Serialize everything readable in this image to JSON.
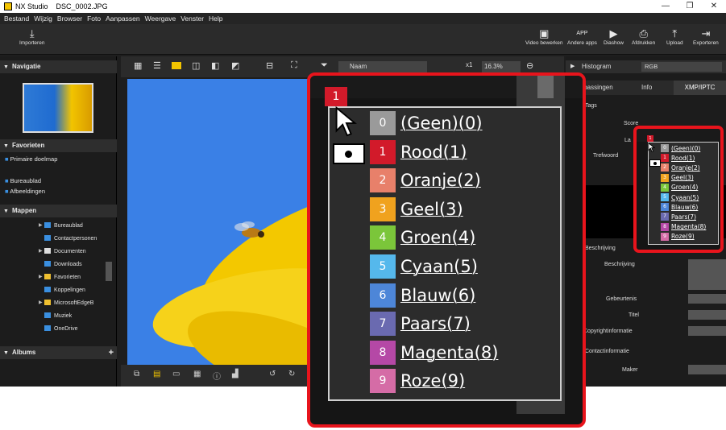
{
  "window": {
    "app_name": "NX Studio",
    "file_name": "DSC_0002.JPG",
    "controls": [
      "—",
      "❐",
      "✕"
    ]
  },
  "menu": [
    "Bestand",
    "Wijzig",
    "Browser",
    "Foto",
    "Aanpassen",
    "Weergave",
    "Venster",
    "Help"
  ],
  "toolbar": {
    "import": "Importeren",
    "video": "Video bewerken",
    "apps": "Andere apps",
    "slideshow": "Diashow",
    "print": "Afdrukken",
    "upload": "Upload",
    "export": "Exporteren",
    "app_badge": "APP"
  },
  "left_panel": {
    "navigation": "Navigatie",
    "favorites": "Favorieten",
    "primary_folder": "Primaire doelmap",
    "desktop": "Bureaublad",
    "pictures": "Afbeeldingen",
    "folders": "Mappen",
    "albums": "Albums",
    "folder_items": [
      "Bureaublad",
      "Contactpersonen",
      "Documenten",
      "Downloads",
      "Favorieten",
      "Koppelingen",
      "MicrosoftEdgeB",
      "Muziek",
      "OneDrive"
    ],
    "add_symbol": "+"
  },
  "viewer": {
    "sort_label": "Naam",
    "zoom_ratio": "x1",
    "zoom_percent": "16.3%"
  },
  "right_panel": {
    "histogram": "Histogram",
    "histogram_mode": "RGB",
    "tabs": [
      "Aanpassingen",
      "Info",
      "XMP/IPTC"
    ],
    "tags": "Tags",
    "score_label": "Score",
    "label_label": "La",
    "keywords_label": "Trefwoord",
    "description_section": "Beschrijving",
    "description_field": "Beschrijving",
    "event": "Gebeurtenis",
    "title": "Titel",
    "copyright": "Copyrightinformatie",
    "contact": "Contactinformatie",
    "maker": "Maker"
  },
  "label_menu": {
    "current_label": "1",
    "selected_index": 1,
    "items": [
      {
        "num": "0",
        "name": "(Geen)(0)",
        "color": "#9a9a9a"
      },
      {
        "num": "1",
        "name": "Rood(1)",
        "color": "#d21a2a"
      },
      {
        "num": "2",
        "name": "Oranje(2)",
        "color": "#e8806a"
      },
      {
        "num": "3",
        "name": "Geel(3)",
        "color": "#f0a21e"
      },
      {
        "num": "4",
        "name": "Groen(4)",
        "color": "#7bc63a"
      },
      {
        "num": "5",
        "name": "Cyaan(5)",
        "color": "#55b8ec"
      },
      {
        "num": "6",
        "name": "Blauw(6)",
        "color": "#4d86d8"
      },
      {
        "num": "7",
        "name": "Paars(7)",
        "color": "#6a6ab0"
      },
      {
        "num": "8",
        "name": "Magenta(8)",
        "color": "#b548a6"
      },
      {
        "num": "9",
        "name": "Roze(9)",
        "color": "#d56ca6"
      }
    ]
  },
  "colors": {
    "callout": "#e8141c",
    "background": "#1e1e1e",
    "menu_bg": "#2c2c2c"
  }
}
